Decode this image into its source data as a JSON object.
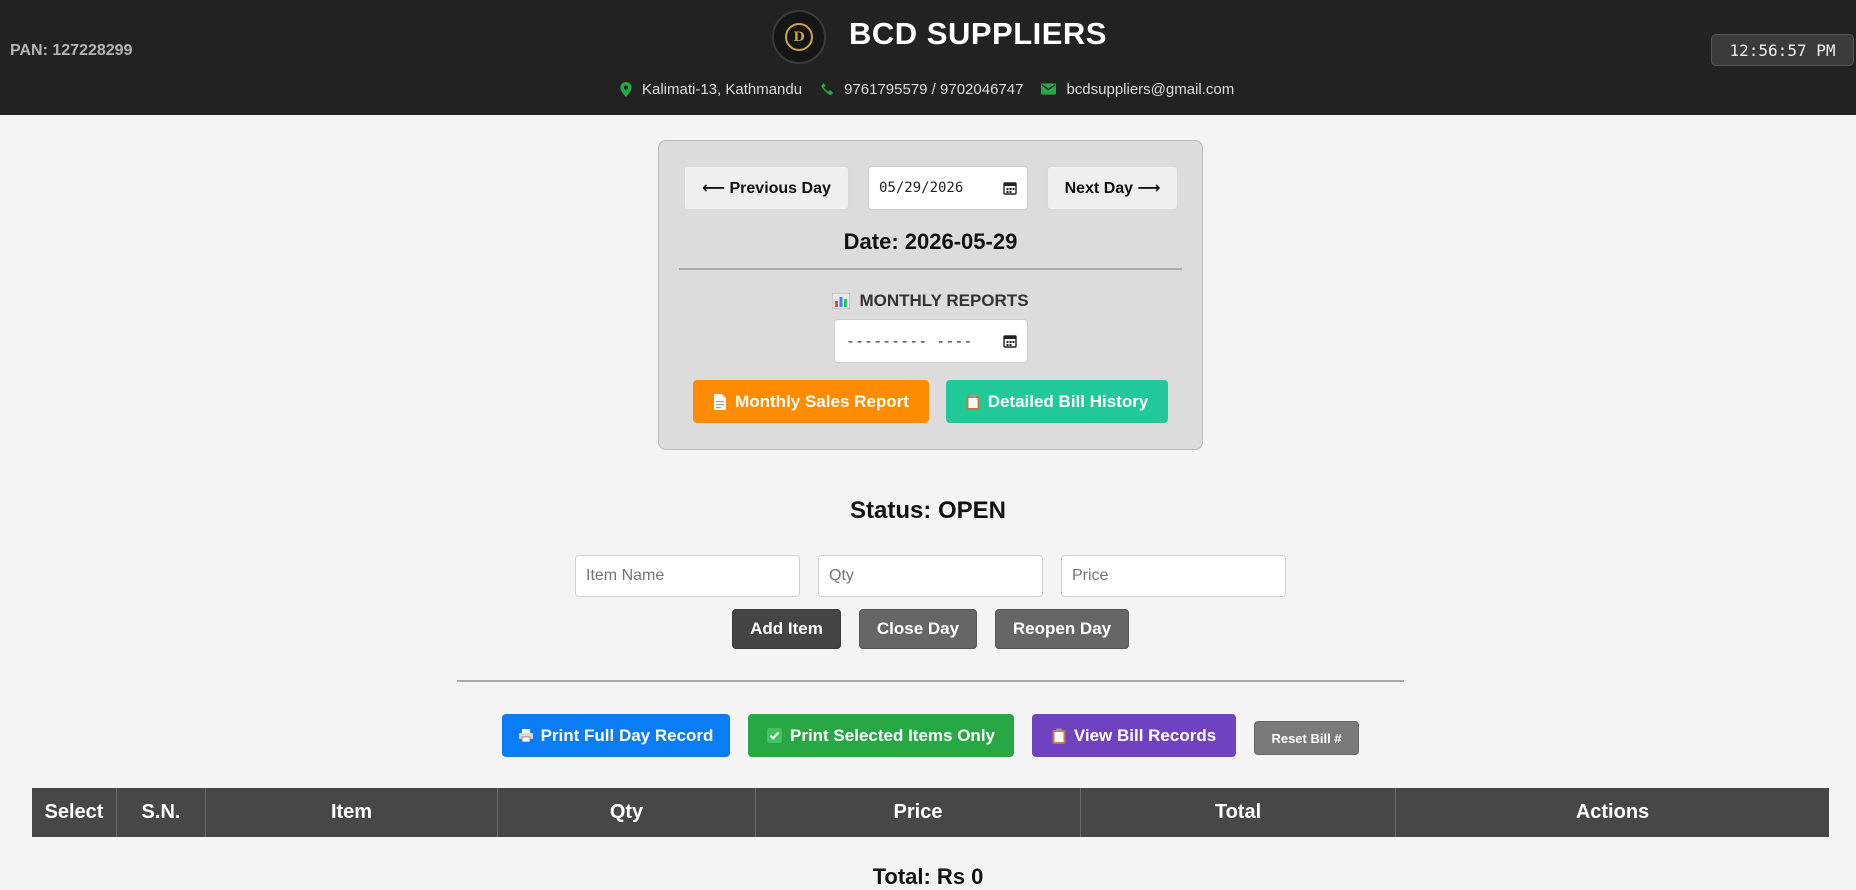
{
  "header": {
    "pan": "PAN: 127228299",
    "brand": "BCD SUPPLIERS",
    "address": "Kalimati-13, Kathmandu",
    "phone": "9761795579 / 9702046747",
    "email": "bcdsuppliers@gmail.com",
    "clock": "12:56:57 PM",
    "logo_text": "D"
  },
  "controls": {
    "prev_label": "⟵ Previous Day",
    "next_label": "Next Day ⟶",
    "date_value": "05/29/2026",
    "date_heading": "Date: 2026-05-29",
    "monthly_title": "MONTHLY REPORTS",
    "month_value": "--------- ----",
    "monthly_sales_label": "Monthly Sales Report",
    "bill_history_label": "Detailed Bill History"
  },
  "status": "Status: OPEN",
  "form": {
    "item_placeholder": "Item Name",
    "qty_placeholder": "Qty",
    "price_placeholder": "Price",
    "add_label": "Add Item",
    "close_label": "Close Day",
    "reopen_label": "Reopen Day"
  },
  "actions": {
    "print_full": "Print Full Day Record",
    "print_selected": "Print Selected Items Only",
    "view_bills": "View Bill Records",
    "reset_bill": "Reset Bill #"
  },
  "table": {
    "headers": [
      "Select",
      "S.N.",
      "Item",
      "Qty",
      "Price",
      "Total",
      "Actions"
    ]
  },
  "total": "Total: Rs 0",
  "colors": {
    "header_bg": "#222222",
    "orange": "#ff8c00",
    "teal": "#20c997",
    "blue": "#0a7cf5",
    "green": "#28a745",
    "purple": "#6f42c1"
  }
}
